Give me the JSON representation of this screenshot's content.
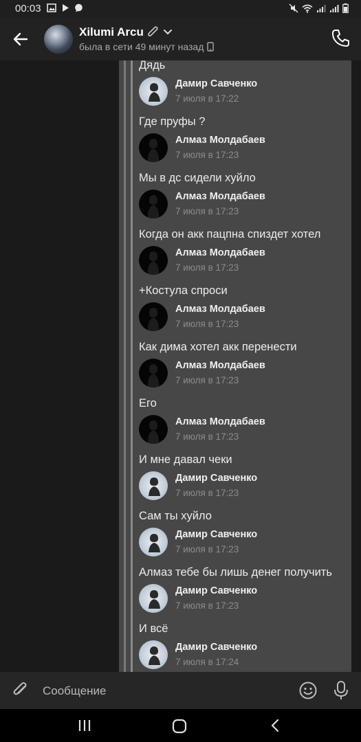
{
  "status_bar": {
    "time": "00:03",
    "left_icons": [
      "image-icon",
      "play-icon",
      "chat-bubble-icon"
    ],
    "right_icons": [
      "mute-icon",
      "wifi-icon",
      "signal-icon",
      "signal-icon",
      "battery-icon"
    ]
  },
  "header": {
    "contact_name": "Xilumi Arcu",
    "status": "была в сети 49 минут назад"
  },
  "messages": [
    {
      "text": "Дядь"
    },
    {
      "author": "Дамир Савченко",
      "date": "7 июля в 17:22",
      "avatar": "damir"
    },
    {
      "text": "Где пруфы ?"
    },
    {
      "author": "Алмаз Молдабаев",
      "date": "7 июля в 17:23",
      "avatar": "almaz"
    },
    {
      "text": "Мы в дс сидели хуйло"
    },
    {
      "author": "Алмаз Молдабаев",
      "date": "7 июля в 17:23",
      "avatar": "almaz"
    },
    {
      "text": "Когда он акк пацпна спиздет хотел"
    },
    {
      "author": "Алмаз Молдабаев",
      "date": "7 июля в 17:23",
      "avatar": "almaz"
    },
    {
      "text": "+Костула спроси"
    },
    {
      "author": "Алмаз Молдабаев",
      "date": "7 июля в 17:23",
      "avatar": "almaz"
    },
    {
      "text": "Как дима хотел акк перенести"
    },
    {
      "author": "Алмаз Молдабаев",
      "date": "7 июля в 17:23",
      "avatar": "almaz"
    },
    {
      "text": "Его"
    },
    {
      "author": "Алмаз Молдабаев",
      "date": "7 июля в 17:23",
      "avatar": "almaz"
    },
    {
      "text": "И мне давал чеки"
    },
    {
      "author": "Дамир Савченко",
      "date": "7 июля в 17:23",
      "avatar": "damir"
    },
    {
      "text": "Сам ты хуйло"
    },
    {
      "author": "Дамир Савченко",
      "date": "7 июля в 17:23",
      "avatar": "damir"
    },
    {
      "text": "Алмаз тебе бы лишь денег получить"
    },
    {
      "author": "Дамир Савченко",
      "date": "7 июля в 17:23",
      "avatar": "damir"
    },
    {
      "text": "И всё"
    },
    {
      "author": "Дамир Савченко",
      "date": "7 июля в 17:24",
      "avatar": "damir"
    }
  ],
  "input": {
    "placeholder": "Сообщение"
  },
  "colors": {
    "background": "#1a1a1a",
    "bubble": "#474747",
    "header": "#222222",
    "text": "#ececec",
    "date": "#8c8c8c"
  }
}
